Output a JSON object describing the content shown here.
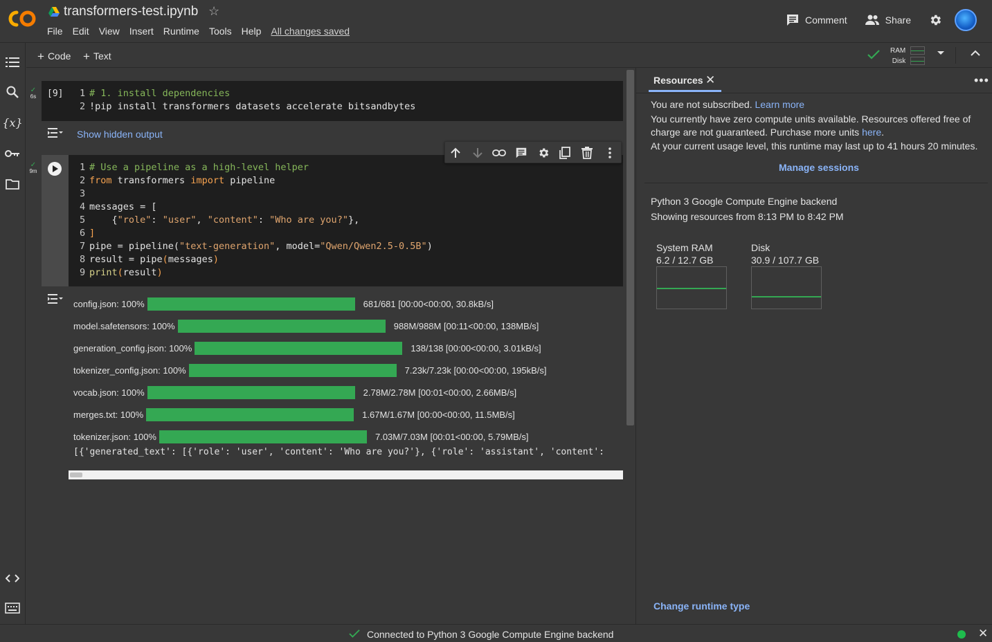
{
  "header": {
    "title": "transformers-test.ipynb",
    "menu": [
      "File",
      "Edit",
      "View",
      "Insert",
      "Runtime",
      "Tools",
      "Help"
    ],
    "saved_status": "All changes saved",
    "comment_label": "Comment",
    "share_label": "Share"
  },
  "toolbar": {
    "add_code": "Code",
    "add_text": "Text",
    "ram_label": "RAM",
    "disk_label": "Disk"
  },
  "cells": {
    "cell1": {
      "exec_count": "[9]",
      "status_time": "6s",
      "lines": [
        {
          "n": "1",
          "text": "# 1. install dependencies"
        },
        {
          "n": "2",
          "text": "!pip install transformers datasets accelerate bitsandbytes"
        }
      ],
      "hidden_output_label": "Show hidden output"
    },
    "cell2": {
      "status_time": "9m",
      "line_numbers": [
        "1",
        "2",
        "3",
        "4",
        "5",
        "6",
        "7",
        "8",
        "9"
      ],
      "code": {
        "l1": "# Use a pipeline as a high-level helper",
        "l2_kw1": "from",
        "l2_mod": " transformers ",
        "l2_kw2": "import",
        "l2_name": " pipeline",
        "l4": "messages = [",
        "l5_a": "    {",
        "l5_k1": "\"role\"",
        "l5_b": ": ",
        "l5_v1": "\"user\"",
        "l5_c": ", ",
        "l5_k2": "\"content\"",
        "l5_d": ": ",
        "l5_v2": "\"Who are you?\"",
        "l5_e": "},",
        "l6": "]",
        "l7_a": "pipe = pipeline(",
        "l7_s1": "\"text-generation\"",
        "l7_b": ", model=",
        "l7_s2": "\"Qwen/Qwen2.5-0.5B\"",
        "l7_c": ")",
        "l8_a": "result = pipe",
        "l8_b": "(",
        "l8_c": "messages",
        "l8_d": ")",
        "l9_a": "print",
        "l9_b": "(",
        "l9_c": "result",
        "l9_d": ")"
      }
    }
  },
  "downloads": [
    {
      "name": "config.json:",
      "pct": "100%",
      "progress": 1.0,
      "stats": "681/681 [00:00<00:00, 30.8kB/s]"
    },
    {
      "name": "model.safetensors:",
      "pct": "100%",
      "progress": 1.0,
      "stats": "988M/988M [00:11<00:00, 138MB/s]"
    },
    {
      "name": "generation_config.json:",
      "pct": "100%",
      "progress": 1.0,
      "stats": "138/138 [00:00<00:00, 3.01kB/s]"
    },
    {
      "name": "tokenizer_config.json:",
      "pct": "100%",
      "progress": 1.0,
      "stats": "7.23k/7.23k [00:00<00:00, 195kB/s]"
    },
    {
      "name": "vocab.json:",
      "pct": "100%",
      "progress": 1.0,
      "stats": "2.78M/2.78M [00:01<00:00, 2.66MB/s]"
    },
    {
      "name": "merges.txt:",
      "pct": "100%",
      "progress": 1.0,
      "stats": "1.67M/1.67M [00:00<00:00, 11.5MB/s]"
    },
    {
      "name": "tokenizer.json:",
      "pct": "100%",
      "progress": 1.0,
      "stats": "7.03M/7.03M [00:01<00:00, 5.79MB/s]"
    }
  ],
  "output_text": "[{'generated_text': [{'role': 'user', 'content': 'Who are you?'}, {'role': 'assistant', 'content': ",
  "panel": {
    "tab_label": "Resources",
    "not_subscribed": "You are not subscribed.",
    "learn_more": "Learn more",
    "zero_units_1": "You currently have zero compute units available. Resources offered free of",
    "zero_units_2": "charge are not guaranteed. Purchase more units",
    "here": "here",
    "period": ".",
    "usage_level": "At your current usage level, this runtime may last up to 41 hours 20 minutes.",
    "manage_sessions": "Manage sessions",
    "backend": "Python 3 Google Compute Engine backend",
    "showing": "Showing resources from 8:13 PM to 8:42 PM",
    "ram_title": "System RAM",
    "ram_value": "6.2 / 12.7 GB",
    "disk_title": "Disk",
    "disk_value": "30.9 / 107.7 GB",
    "change_runtime": "Change runtime type"
  },
  "status": {
    "connected": "Connected to Python 3 Google Compute Engine backend"
  },
  "colors": {
    "accent_link": "#8ab4f8",
    "progress_green": "#34a853",
    "background": "#383838",
    "code_bg": "#1e1e1e"
  }
}
